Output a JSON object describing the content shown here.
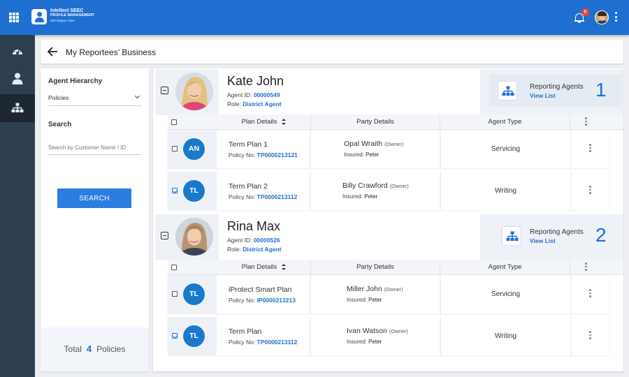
{
  "brand": {
    "line1": "Intellect SEEC",
    "line2": "PROFILE MANAGEMENT",
    "line3": "360 Degree View"
  },
  "notifications": {
    "count": "6"
  },
  "icons": {
    "apps": "apps-grid-icon",
    "bell": "bell-icon",
    "back": "arrow-left-icon",
    "rail": [
      "dashboard-icon",
      "person-icon",
      "hierarchy-icon"
    ],
    "reporting": "hierarchy-icon",
    "more": "kebab-vertical-icon"
  },
  "header": {
    "title": "My Reportees’ Business"
  },
  "filter": {
    "hierarchy_label": "Agent Hierarchy",
    "hierarchy_value": "Policies",
    "search_label": "Search",
    "search_placeholder": "Search by Customer Name / ID",
    "search_button": "SEARCH",
    "total_label": "Total",
    "total_count": "4",
    "total_unit": "Policies"
  },
  "table_headers": {
    "plan": "Plan Details",
    "party": "Party Details",
    "type": "Agent Type"
  },
  "agents": [
    {
      "name": "Kate John",
      "agent_id_label": "Agent ID: ",
      "agent_id": "00000549",
      "role_label": "Role: ",
      "role": "District Agent",
      "reporting_label": "Reporting Agents",
      "view_list": "View List",
      "reporting_count": "1",
      "policies": [
        {
          "initials": "AN",
          "plan": "Term Plan 1",
          "policy_label": "Policy No: ",
          "policy_no": "TP0000213121",
          "party": "Opal Wraith",
          "party_role": "(Owner)",
          "insured_label": "Insured: ",
          "insured": "Peter",
          "agent_type": "Servicing",
          "checked": false
        },
        {
          "initials": "TL",
          "plan": "Term Plan 2",
          "policy_label": "Policy No: ",
          "policy_no": "TP0000213112",
          "party": "Billy Crawford",
          "party_role": "(Owner)",
          "insured_label": "Insured: ",
          "insured": "Peter",
          "agent_type": "Writing",
          "checked": true
        }
      ]
    },
    {
      "name": "Rina Max",
      "agent_id_label": "Agent ID: ",
      "agent_id": "00000526",
      "role_label": "Role: ",
      "role": "District Agent",
      "reporting_label": "Reporting Agents",
      "view_list": "View List",
      "reporting_count": "2",
      "policies": [
        {
          "initials": "TL",
          "plan": "iProtect Smart Plan",
          "policy_label": "Policy No: ",
          "policy_no": "IP0000213213",
          "party": "Miller John",
          "party_role": "(Owner)",
          "insured_label": "Insured: ",
          "insured": "Peter",
          "agent_type": "Servicing",
          "checked": false
        },
        {
          "initials": "TL",
          "plan": "Term Plan",
          "policy_label": "Policy No: ",
          "policy_no": "TP0000213112",
          "party": "Ivan Watson",
          "party_role": "(Owner)",
          "insured_label": "Insured: ",
          "insured": "Peter",
          "agent_type": "Writing",
          "checked": true
        }
      ]
    }
  ]
}
